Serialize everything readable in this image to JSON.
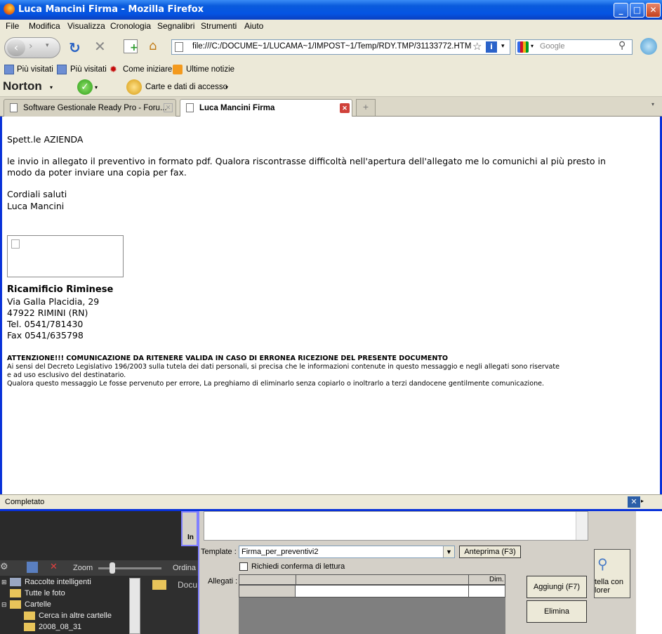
{
  "window": {
    "title": "Luca Mancini Firma - Mozilla Firefox",
    "min": "_",
    "max": "□",
    "close": "✕"
  },
  "menu": [
    "File",
    "Modifica",
    "Visualizza",
    "Cronologia",
    "Segnalibri",
    "Strumenti",
    "Aiuto"
  ],
  "nav": {
    "address": "file:///C:/DOCUME~1/LUCAMA~1/IMPOST~1/Temp/RDY.TMP/31133772.HTM",
    "search_placeholder": "Google"
  },
  "bookmarks": [
    "Più visitati",
    "Più visitati",
    "Come iniziare",
    "Ultime notizie"
  ],
  "norton": {
    "brand": "Norton",
    "vault": "Carte e dati di accesso"
  },
  "tabs": [
    {
      "label": "Software Gestionale Ready Pro - Foru..."
    },
    {
      "label": "Luca Mancini Firma"
    }
  ],
  "email": {
    "greeting": "Spett.le AZIENDA",
    "body1": "le invio in allegato il preventivo in formato pdf. Qualora riscontrasse difficoltà nell'apertura dell'allegato me lo comunichi al più presto in",
    "body2": "modo da poter inviare una copia per fax.",
    "closing1": "Cordiali saluti",
    "closing2": "Luca Mancini",
    "company": "Ricamificio Riminese",
    "addr1": "Via Galla Placidia, 29",
    "addr2": "47922  RIMINI (RN)",
    "tel": "Tel. 0541/781430",
    "fax": "Fax 0541/635798",
    "warn_title": "ATTENZIONE!!! COMUNICAZIONE DA RITENERE VALIDA IN CASO DI ERRONEA RICEZIONE DEL PRESENTE DOCUMENTO",
    "warn1": "Ai sensi del Decreto Legislativo 196/2003 sulla tutela dei dati personali, si precisa che le informazioni contenute in questo messaggio e negli allegati sono riservate",
    "warn2": "e ad uso esclusivo del destinatario.",
    "warn3": "Qualora questo messaggio Le fosse pervenuto per errore, La preghiamo di eliminarlo senza copiarlo o inoltrarlo a terzi dandocene gentilmente comunicazione."
  },
  "status": "Completato",
  "background_app": {
    "zoom": "Zoom",
    "ordina": "Ordina",
    "docu": "Docu",
    "tree": [
      "Raccolte intelligenti",
      "Tutte le foto",
      "Cartelle",
      "Cerca in altre cartelle",
      "2008_08_31"
    ],
    "right_btn1": "tella con",
    "right_btn2": "lorer",
    "in_label": "In"
  },
  "dialog": {
    "template_label": "Template :",
    "template_value": "Firma_per_preventivi2",
    "preview_btn": "Anteprima (F3)",
    "read_receipt": "Richiedi conferma di lettura",
    "attach_label": "Allegati :",
    "dim_header": "Dim.",
    "add_btn": "Aggiungi (F7)",
    "del_btn": "Elimina"
  }
}
